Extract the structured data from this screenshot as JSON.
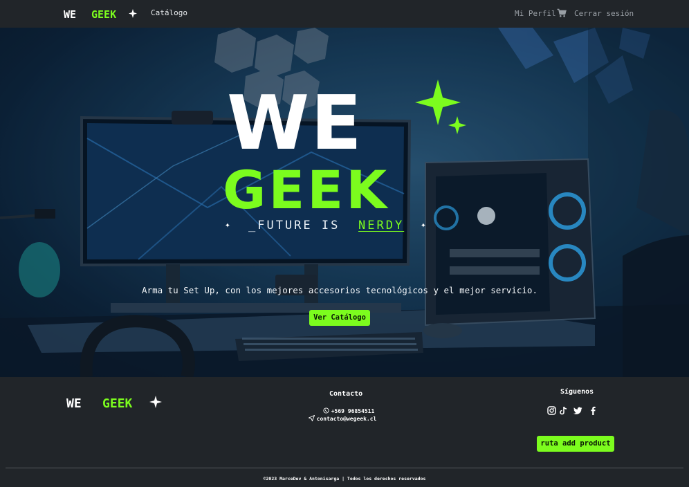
{
  "navbar": {
    "brand_we": "WE",
    "brand_geek": "GEEK",
    "catalog_label": "Catálogo",
    "profile_label": "Mi Perfil",
    "cart_icon": "shopping-cart-icon",
    "logout_label": "Cerrar sesión"
  },
  "hero": {
    "logo_we": "WE",
    "logo_geek": "GEEK",
    "tagline_prefix": "_FUTURE IS",
    "tagline_highlight": "NERDY",
    "description": "Arma tu Set Up, con los mejores accesorios tecnológicos y el mejor servicio.",
    "cta_label": "Ver Catálogo"
  },
  "footer": {
    "brand_we": "WE",
    "brand_geek": "GEEK",
    "contact_title": "Contacto",
    "phone": "+569 96854511",
    "phone_icon": "whatsapp-icon",
    "email": "contacto@wegeek.cl",
    "email_icon": "paper-plane-icon",
    "follow_title": "Síguenos",
    "socials": [
      "instagram-icon",
      "tiktok-icon",
      "twitter-icon",
      "facebook-icon"
    ],
    "add_product_label": "ruta add product",
    "copyright": "©2023 MarceDev & Antonisarga | Todos los derechos reservados"
  },
  "colors": {
    "accent": "#7cfc1e",
    "background": "#212529",
    "text": "#ffffff"
  }
}
